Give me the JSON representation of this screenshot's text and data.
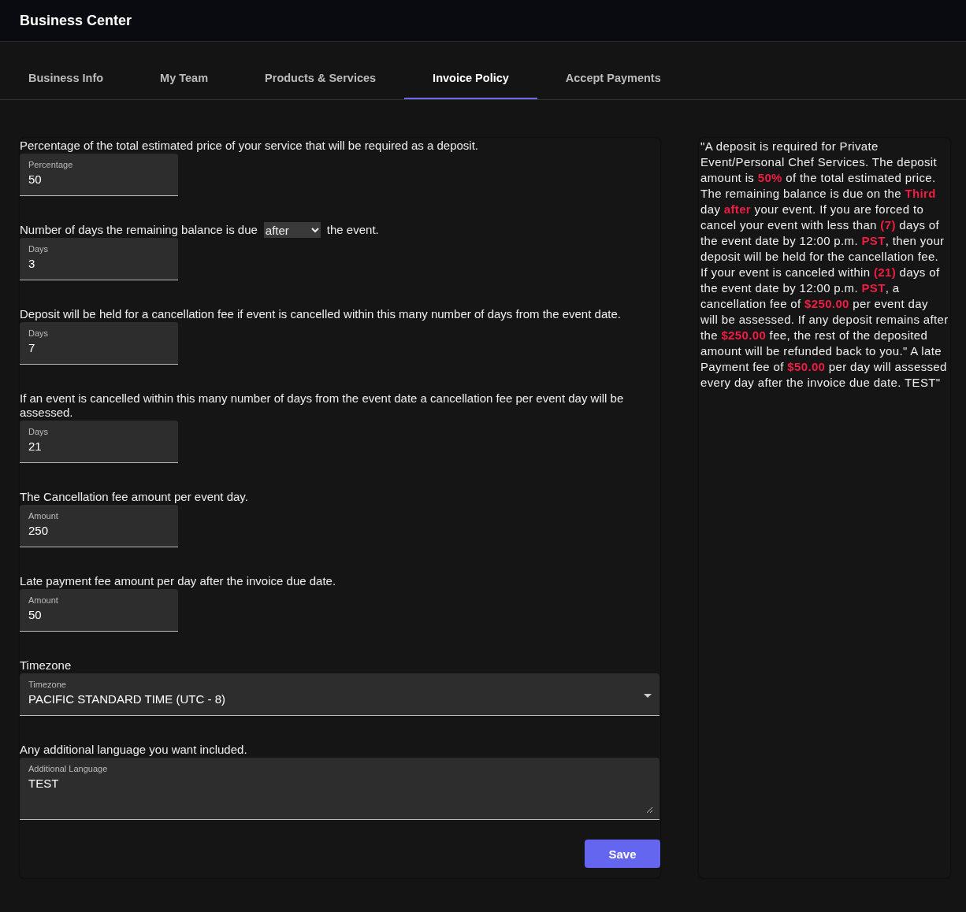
{
  "header": {
    "title": "Business Center"
  },
  "tabs": [
    {
      "label": "Business Info",
      "selected": false
    },
    {
      "label": "My Team",
      "selected": false
    },
    {
      "label": "Products & Services",
      "selected": false
    },
    {
      "label": "Invoice Policy",
      "selected": true
    },
    {
      "label": "Accept Payments",
      "selected": false
    }
  ],
  "form": {
    "sections": [
      {
        "kind": "text",
        "prompt": "Percentage of the total estimated price of your service that will be required as a deposit.",
        "field": {
          "label": "Percentage",
          "value": "50"
        }
      },
      {
        "kind": "select_prompt",
        "prompt": "Number of days the remaining balance is due",
        "select": "after",
        "prompt_after": "the event.",
        "field": {
          "label": "Days",
          "value": "3"
        }
      },
      {
        "kind": "text",
        "prompt": "Deposit will be held for a cancellation fee if event is cancelled within this many number of days from the event date.",
        "field": {
          "label": "Days",
          "value": "7"
        }
      },
      {
        "kind": "text",
        "prompt": "If an event is cancelled within this many number of days from the event date a cancellation fee per event day will be assessed.",
        "field": {
          "label": "Days",
          "value": "21"
        }
      },
      {
        "kind": "text",
        "prompt": "The Cancellation fee amount per event day.",
        "field": {
          "label": "Amount",
          "value": "250"
        }
      },
      {
        "kind": "text",
        "prompt": "Late payment fee amount per day after the invoice due date.",
        "field": {
          "label": "Amount",
          "value": "50"
        }
      },
      {
        "kind": "dropdown",
        "prompt": "Timezone",
        "field": {
          "label": "Timezone",
          "value": "PACIFIC STANDARD TIME (UTC - 8)"
        }
      },
      {
        "kind": "textarea",
        "prompt": "Any additional language you want included.",
        "field": {
          "label": "Additional Language",
          "value": "TEST"
        }
      }
    ],
    "save_button": "Save"
  },
  "preview": {
    "text": "\"A deposit is required for Private Event/Personal Chef Services. The deposit amount is **50%** of the total estimated price. The remaining balance is due on the **Third** day **after** your event. If you are forced to cancel your event with less than **(7)** days of the event date by 12:00 p.m. **PST**, then your deposit will be held for the cancellation fee. If your event is canceled within **(21)** days of the event date by 12:00 p.m. **PST**, a cancellation fee of **$250.00** per event day will be assessed. If any deposit remains after the **$250.00** fee, the rest of the deposited amount will be refunded back to you.\" A late Payment fee of **$50.00** per day will assessed every day after the invoice due date. TEST\""
  }
}
